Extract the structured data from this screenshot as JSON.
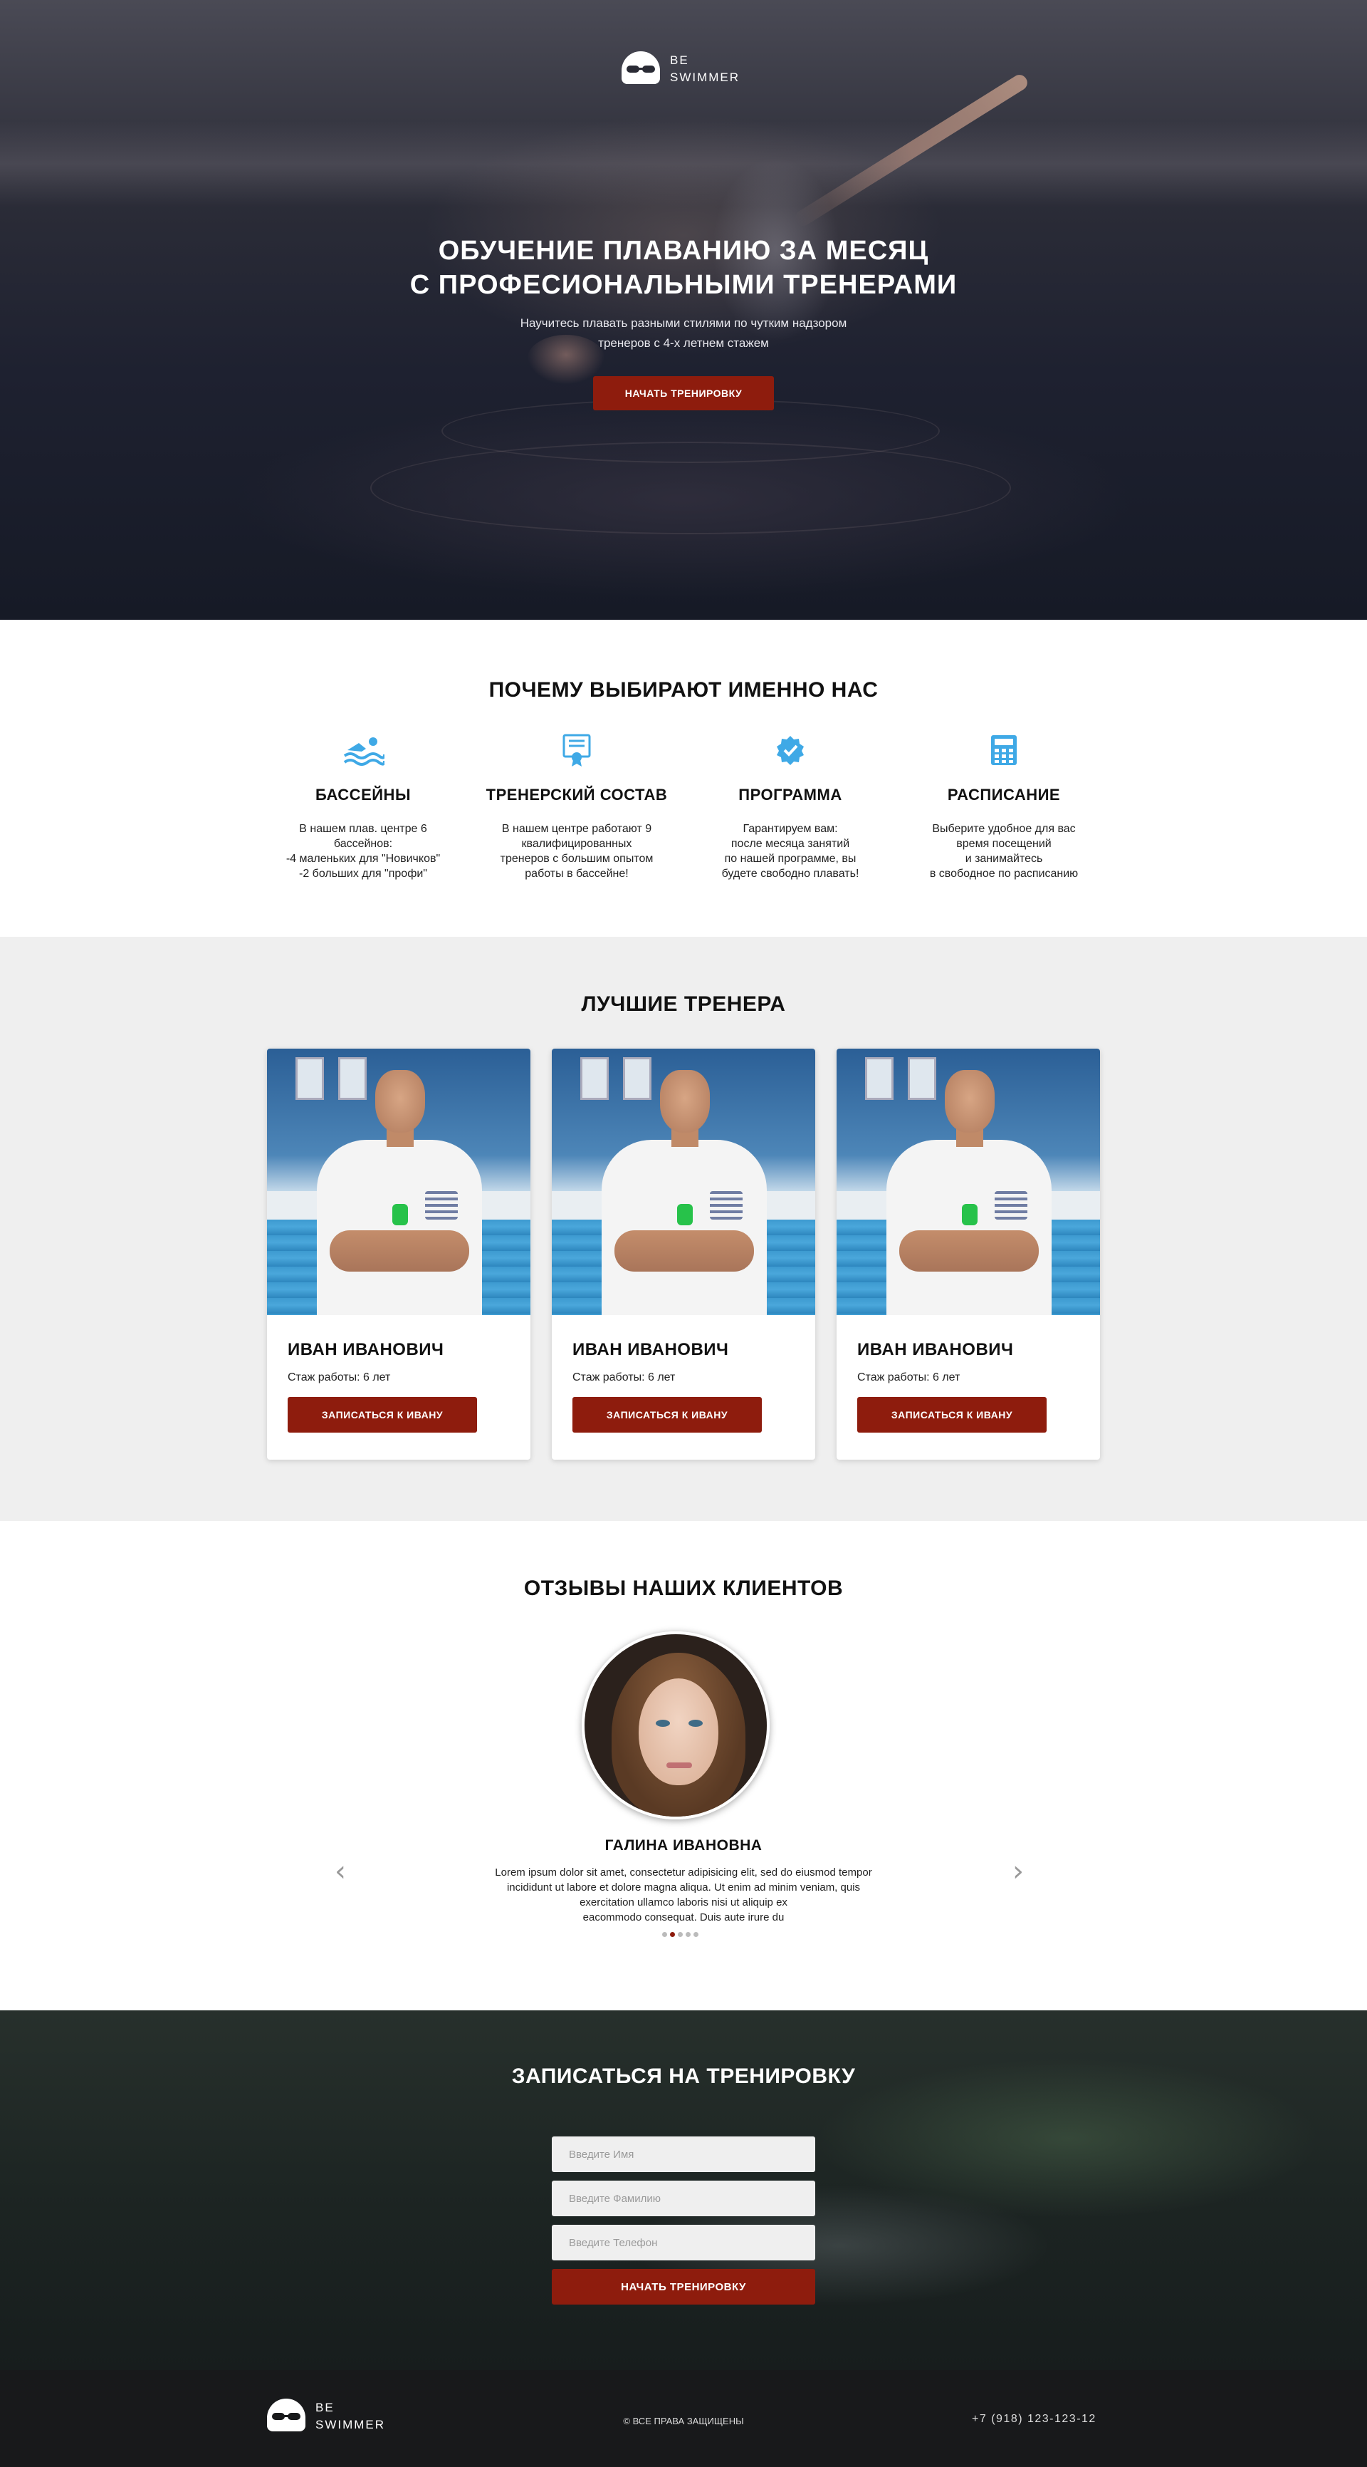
{
  "brand": {
    "line1": "BE",
    "line2": "SWIMMER"
  },
  "hero": {
    "title_line1": "ОБУЧЕНИЕ ПЛАВАНИЮ ЗА МЕСЯЦ",
    "title_line2": "С ПРОФЕСИОНАЛЬНЫМИ ТРЕНЕРАМИ",
    "subtitle_line1": "Научитесь плавать разными стилями по чутким надзором",
    "subtitle_line2": "тренеров с 4-х летнем стажем",
    "cta_label": "НАЧАТЬ ТРЕНИРОВКУ"
  },
  "why": {
    "title": "ПОЧЕМУ ВЫБИРАЮТ ИМЕННО НАС",
    "features": [
      {
        "icon": "swimmer-icon",
        "title": "БАССЕЙНЫ",
        "text": "В нашем плав. центре 6\nбассейнов:\n-4 маленьких для \"Новичков\"\n-2 больших для \"профи\""
      },
      {
        "icon": "certificate-icon",
        "title": "ТРЕНЕРСКИЙ СОСТАВ",
        "text": "В нашем центре  работают 9\nквалифицированных\nтренеров с большим опытом\nработы в бассейне!"
      },
      {
        "icon": "verified-badge-icon",
        "title": "ПРОГРАММА",
        "text": "Гарантируем вам:\nпосле месяца занятий\nпо нашей программе, вы\nбудете свободно плавать!"
      },
      {
        "icon": "calendar-icon",
        "title": "РАСПИСАНИЕ",
        "text": "Выберите удобное для вас\nвремя посещений\nи занимайтесь\nв свободное по расписанию"
      }
    ]
  },
  "trainers": {
    "title": "ЛУЧШИЕ ТРЕНЕРА",
    "cards": [
      {
        "name": "ИВАН ИВАНОВИЧ",
        "experience": "Стаж работы: 6 лет",
        "button": "ЗАПИСАТЬСЯ К ИВАНУ"
      },
      {
        "name": "ИВАН ИВАНОВИЧ",
        "experience": "Стаж работы: 6 лет",
        "button": "ЗАПИСАТЬСЯ К ИВАНУ"
      },
      {
        "name": "ИВАН ИВАНОВИЧ",
        "experience": "Стаж работы: 6 лет",
        "button": "ЗАПИСАТЬСЯ К ИВАНУ"
      }
    ]
  },
  "reviews": {
    "title": "ОТЗЫВЫ НАШИХ КЛИЕНТОВ",
    "prev_arrow": "‹",
    "next_arrow": "›",
    "reviewer": "ГАЛИНА ИВАНОВНА",
    "text": "Lorem ipsum dolor sit amet, consectetur adipisicing elit, sed do eiusmod tempor\nincididunt ut labore et dolore magna aliqua. Ut enim ad minim veniam, quis\nexercitation ullamco laboris nisi ut aliquip ex\neacommodo consequat. Duis aute irure du",
    "slide_count": 5,
    "active_slide": 2
  },
  "signup": {
    "title": "ЗАПИСАТЬСЯ НА ТРЕНИРОВКУ",
    "name_placeholder": "Введите Имя",
    "surname_placeholder": "Введите Фамилию",
    "phone_placeholder": "Введите Телефон",
    "submit_label": "НАЧАТЬ ТРЕНИРОВКУ"
  },
  "footer": {
    "copyright": "© ВСЕ ПРАВА ЗАЩИЩЕНЫ",
    "phone": "+7 (918) 123-123-12"
  },
  "colors": {
    "accent": "#8e1c0d",
    "icon_blue": "#3fa9e6",
    "section_gray": "#efefef",
    "footer_bg": "#18191b"
  }
}
